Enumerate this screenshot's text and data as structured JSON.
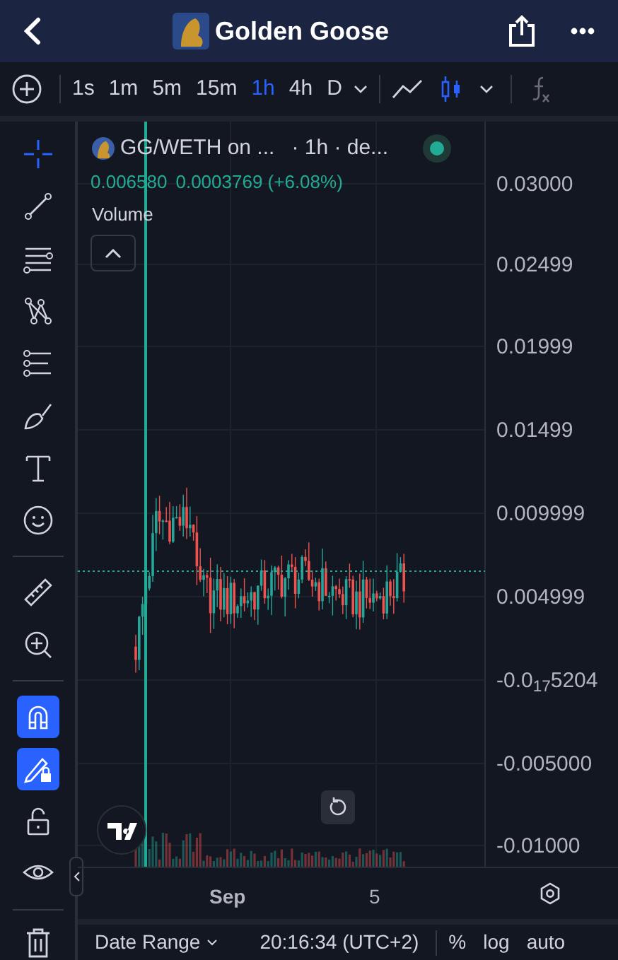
{
  "header": {
    "title": "Golden Goose"
  },
  "timeframes": [
    {
      "label": "1s",
      "selected": false
    },
    {
      "label": "1m",
      "selected": false
    },
    {
      "label": "5m",
      "selected": false
    },
    {
      "label": "15m",
      "selected": false
    },
    {
      "label": "1h",
      "selected": true
    },
    {
      "label": "4h",
      "selected": false
    },
    {
      "label": "D",
      "selected": false
    }
  ],
  "chart_types": [
    {
      "kind": "line",
      "selected": false
    },
    {
      "kind": "candles",
      "selected": true
    }
  ],
  "tools": [
    {
      "kind": "crosshair",
      "selected": true
    },
    {
      "kind": "trendline",
      "selected": false
    },
    {
      "kind": "lines",
      "selected": false
    },
    {
      "kind": "pattern",
      "selected": false
    },
    {
      "kind": "fib",
      "selected": false
    },
    {
      "kind": "brush",
      "selected": false
    },
    {
      "kind": "text",
      "selected": false
    },
    {
      "kind": "emoji",
      "selected": false
    },
    {
      "kind": "divider"
    },
    {
      "kind": "ruler",
      "selected": false
    },
    {
      "kind": "zoom",
      "selected": false
    },
    {
      "kind": "divider"
    },
    {
      "kind": "magnet",
      "selected": true
    },
    {
      "kind": "lockdraw",
      "selected": true
    },
    {
      "kind": "unlock",
      "selected": false
    },
    {
      "kind": "eye",
      "selected": false
    }
  ],
  "legend": {
    "symbol": "GG/WETH on ...",
    "details": "· 1h · de...",
    "last": "0.006580",
    "change": "0.0003769 (+6.08%)",
    "indicator": "Volume"
  },
  "price_axis": [
    "0.03000",
    "0.02499",
    "0.01999",
    "0.01499",
    "0.009999",
    "0.004999",
    "-0.0$_{17}$5204",
    "-0.005000",
    "-0.01000"
  ],
  "time_axis": [
    "Sep",
    "5"
  ],
  "bottom_bar": {
    "range": "Date Range",
    "clock": "20:16:34 (UTC+2)",
    "options": [
      "%",
      "log",
      "auto"
    ]
  }
}
